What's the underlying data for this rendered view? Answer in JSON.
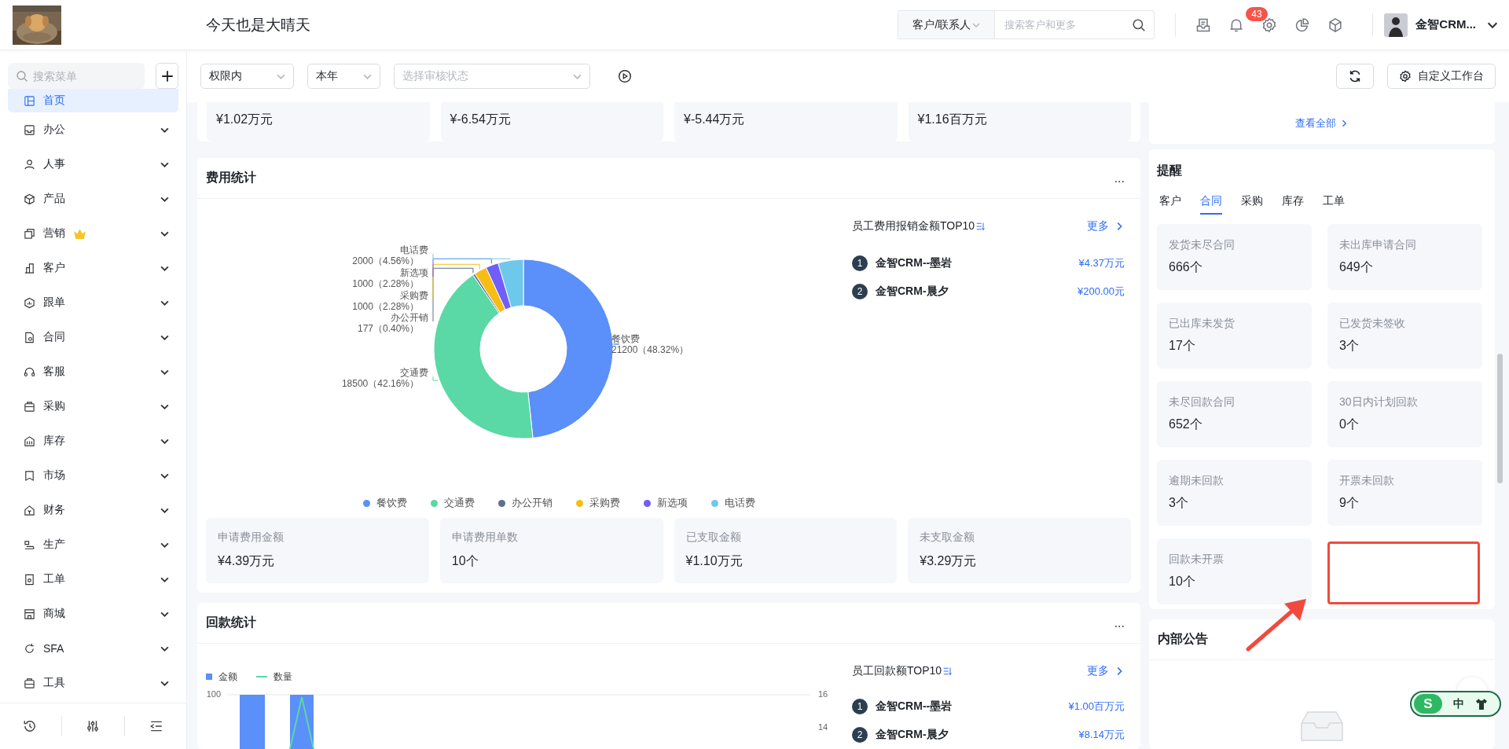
{
  "header": {
    "title": "今天也是大晴天",
    "search": {
      "scope": "客户/联系人",
      "placeholder": "搜索客户和更多"
    },
    "notifications": "43",
    "user": "金智CRM..."
  },
  "sidebar": {
    "search_placeholder": "搜索菜单",
    "items": [
      {
        "label": "首页",
        "selected": true,
        "expandable": false,
        "premium": false
      },
      {
        "label": "办公",
        "selected": false,
        "expandable": true,
        "premium": false
      },
      {
        "label": "人事",
        "selected": false,
        "expandable": true,
        "premium": false
      },
      {
        "label": "产品",
        "selected": false,
        "expandable": true,
        "premium": false
      },
      {
        "label": "营销",
        "selected": false,
        "expandable": true,
        "premium": true
      },
      {
        "label": "客户",
        "selected": false,
        "expandable": true,
        "premium": false
      },
      {
        "label": "跟单",
        "selected": false,
        "expandable": true,
        "premium": false
      },
      {
        "label": "合同",
        "selected": false,
        "expandable": true,
        "premium": false
      },
      {
        "label": "客服",
        "selected": false,
        "expandable": true,
        "premium": false
      },
      {
        "label": "采购",
        "selected": false,
        "expandable": true,
        "premium": false
      },
      {
        "label": "库存",
        "selected": false,
        "expandable": true,
        "premium": false
      },
      {
        "label": "市场",
        "selected": false,
        "expandable": true,
        "premium": false
      },
      {
        "label": "财务",
        "selected": false,
        "expandable": true,
        "premium": false
      },
      {
        "label": "生产",
        "selected": false,
        "expandable": true,
        "premium": false
      },
      {
        "label": "工单",
        "selected": false,
        "expandable": true,
        "premium": false
      },
      {
        "label": "商城",
        "selected": false,
        "expandable": true,
        "premium": false
      },
      {
        "label": "SFA",
        "selected": false,
        "expandable": true,
        "premium": false
      },
      {
        "label": "工具",
        "selected": false,
        "expandable": true,
        "premium": false
      }
    ]
  },
  "filters": [
    {
      "kind": "select",
      "value": "权限内"
    },
    {
      "kind": "select",
      "value": "本年"
    },
    {
      "kind": "placeholder",
      "value": "选择审核状态"
    }
  ],
  "customize_button": "自定义工作台",
  "summary_values": [
    "¥1.02万元",
    "¥-6.54万元",
    "¥-5.44万元",
    "¥1.16百万元"
  ],
  "fee_panel": {
    "title": "费用统计",
    "menu": "...",
    "chart_data": {
      "type": "donut",
      "categories": [
        "餐饮费",
        "交通费",
        "办公开销",
        "采购费",
        "新选项",
        "电话费"
      ],
      "values": [
        48.32,
        42.16,
        0.4,
        2.28,
        2.28,
        4.56
      ],
      "colors": [
        "#5b8ff9",
        "#5ad8a6",
        "#5d7092",
        "#f6bd16",
        "#6f5ef9",
        "#6dc8ec"
      ],
      "value_labels": [
        "21200（48.32%）",
        "18500（42.16%）",
        "177（0.40%）",
        "1000（2.28%）",
        "1000（2.28%）",
        "2000（4.56%）"
      ]
    },
    "ranking": {
      "title": "员工费用报销金额TOP10",
      "more": "更多",
      "rows": [
        {
          "rank": "1",
          "name": "金智CRM--墨岩",
          "amount": "¥4.37万元"
        },
        {
          "rank": "2",
          "name": "金智CRM-晨夕",
          "amount": "¥200.00元"
        }
      ]
    },
    "stats": [
      {
        "label": "申请费用金额",
        "value": "¥4.39万元"
      },
      {
        "label": "申请费用单数",
        "value": "10个"
      },
      {
        "label": "已支取金额",
        "value": "¥1.10万元"
      },
      {
        "label": "未支取金额",
        "value": "¥3.29万元"
      }
    ]
  },
  "payment_panel": {
    "title": "回款统计",
    "menu": "...",
    "legend": [
      {
        "kind": "bar",
        "name": "金额",
        "color": "#5b8ff9"
      },
      {
        "kind": "line",
        "name": "数量",
        "color": "#5ad8a6"
      }
    ],
    "left_tick": "100",
    "right_ticks": [
      "16",
      "14"
    ],
    "ranking": {
      "title": "员工回款额TOP10",
      "more": "更多",
      "rows": [
        {
          "rank": "1",
          "name": "金智CRM--墨岩",
          "amount": "¥1.00百万元"
        },
        {
          "rank": "2",
          "name": "金智CRM-晨夕",
          "amount": "¥8.14万元"
        }
      ]
    }
  },
  "overview_card": {
    "link": "查看全部"
  },
  "reminder_panel": {
    "title": "提醒",
    "tabs": [
      {
        "label": "客户",
        "selected": false
      },
      {
        "label": "合同",
        "selected": true
      },
      {
        "label": "采购",
        "selected": false
      },
      {
        "label": "库存",
        "selected": false
      },
      {
        "label": "工单",
        "selected": false
      }
    ],
    "tiles": [
      {
        "label": "发货未尽合同",
        "value": "666个"
      },
      {
        "label": "未出库申请合同",
        "value": "649个"
      },
      {
        "label": "已出库未发货",
        "value": "17个"
      },
      {
        "label": "已发货未签收",
        "value": "3个"
      },
      {
        "label": "未尽回款合同",
        "value": "652个"
      },
      {
        "label": "30日内计划回款",
        "value": "0个"
      },
      {
        "label": "逾期未回款",
        "value": "3个"
      },
      {
        "label": "开票未回款",
        "value": "9个"
      },
      {
        "label": "回款未开票",
        "value": "10个"
      }
    ]
  },
  "notice_panel": {
    "title": "内部公告"
  },
  "floating_widget": {
    "logo": "S",
    "label": "中"
  }
}
